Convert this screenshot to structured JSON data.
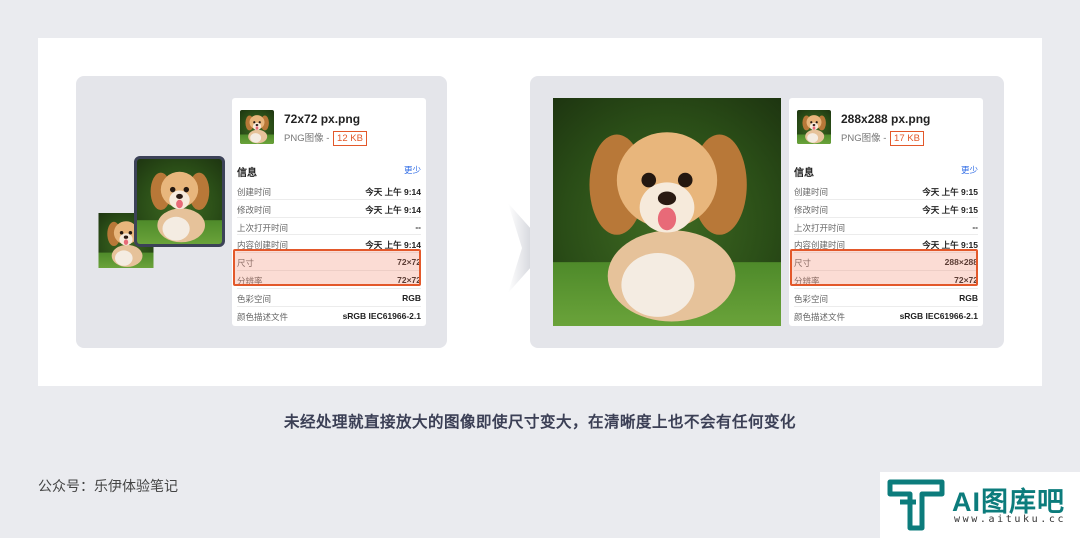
{
  "left_panel": {
    "file_name": "72x72 px.png",
    "file_type": "PNG图像 - ",
    "file_size": "12 KB",
    "section_title": "信息",
    "more_label": "更少",
    "rows": [
      {
        "label": "创建时间",
        "value": "今天 上午 9:14"
      },
      {
        "label": "修改时间",
        "value": "今天 上午 9:14"
      },
      {
        "label": "上次打开时间",
        "value": "--"
      },
      {
        "label": "内容创建时间",
        "value": "今天 上午 9:14"
      },
      {
        "label": "尺寸",
        "value": "72×72"
      },
      {
        "label": "分辨率",
        "value": "72×72"
      },
      {
        "label": "色彩空间",
        "value": "RGB"
      },
      {
        "label": "颜色描述文件",
        "value": "sRGB IEC61966-2.1"
      }
    ]
  },
  "right_panel": {
    "file_name": "288x288 px.png",
    "file_type": "PNG图像 - ",
    "file_size": "17 KB",
    "section_title": "信息",
    "more_label": "更少",
    "rows": [
      {
        "label": "创建时间",
        "value": "今天 上午 9:15"
      },
      {
        "label": "修改时间",
        "value": "今天 上午 9:15"
      },
      {
        "label": "上次打开时间",
        "value": "--"
      },
      {
        "label": "内容创建时间",
        "value": "今天 上午 9:15"
      },
      {
        "label": "尺寸",
        "value": "288×288"
      },
      {
        "label": "分辨率",
        "value": "72×72"
      },
      {
        "label": "色彩空间",
        "value": "RGB"
      },
      {
        "label": "颜色描述文件",
        "value": "sRGB IEC61966-2.1"
      }
    ]
  },
  "caption": "未经处理就直接放大的图像即使尺寸变大，在清晰度上也不会有任何变化",
  "account": "公众号：乐伊体验笔记",
  "watermark": {
    "brand": "AI图库吧",
    "url": "www.aituku.cc"
  },
  "colors": {
    "accent_border": "#e3582a",
    "link_blue": "#2e6be6",
    "logo_teal": "#0c7c7c"
  }
}
